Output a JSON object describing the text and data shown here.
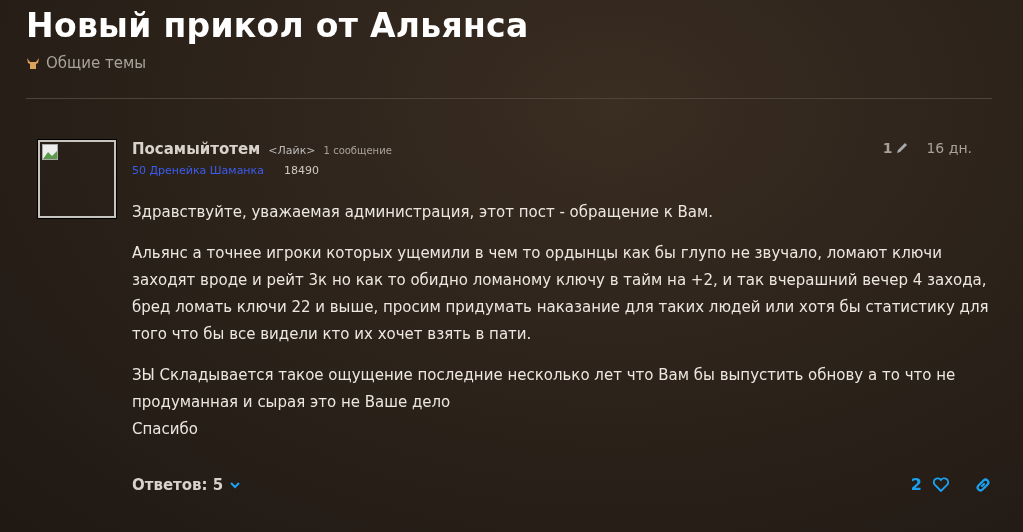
{
  "topic": {
    "title": "Новый прикол от Альянса",
    "category": "Общие темы"
  },
  "post": {
    "author": "Посамыйтотем",
    "guild": "<Лайк>",
    "post_count": "1 сообщение",
    "character": "50 Дренейка Шаманка",
    "achievement_points": "18490",
    "edits": "1",
    "age": "16 дн.",
    "paragraphs": [
      {
        "lines": [
          "Здравствуйте, уважаемая администрация, этот пост - обращение к Вам."
        ]
      },
      {
        "lines": [
          "Альянс а точнее игроки которых ущемили в чем то ордынцы как бы глупо не звучало, ломают ключи",
          "заходят вроде и рейт 3к но как то обидно ломаному ключу в тайм на +2, и так вчерашний вечер 4 захода,",
          "бред ломать ключи 22 и выше, просим придумать наказание для таких людей или хотя бы статистику для",
          "того что бы все видели кто их хочет взять в пати."
        ]
      },
      {
        "lines": [
          "ЗЫ Складывается такое ощущение последние несколько лет что Вам бы выпустить обнову а то что не",
          "продуманная и сырая это не Ваше дело",
          "Спасибо"
        ]
      }
    ],
    "replies": "Ответов: 5",
    "likes": "2"
  }
}
